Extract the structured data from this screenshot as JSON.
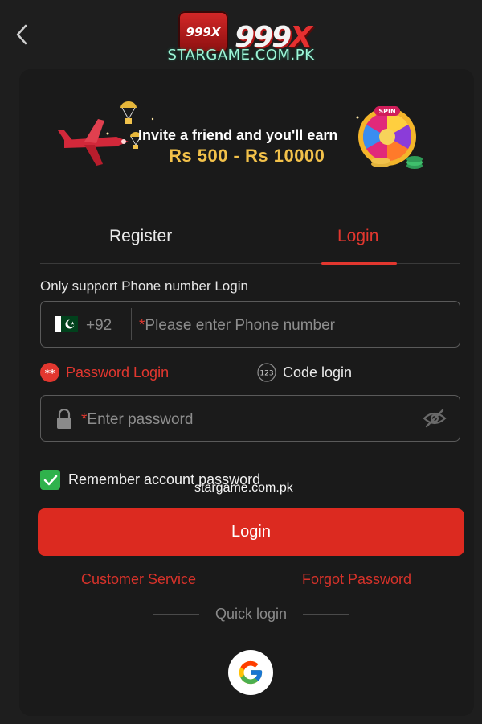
{
  "header": {
    "logo_badge_text": "999X",
    "logo_word_main": "999",
    "logo_word_x": "X",
    "site_caption": "STARGAME.COM.PK"
  },
  "banner": {
    "line1": "Invite a friend and you'll earn",
    "line2": "Rs 500 - Rs 10000",
    "wheel_label": "SPIN"
  },
  "tabs": [
    {
      "label": "Register",
      "active": false
    },
    {
      "label": "Login",
      "active": true
    }
  ],
  "form": {
    "support_text": "Only support Phone number Login",
    "phone": {
      "country_code": "+92",
      "required_mark": "*",
      "placeholder": "Please enter Phone number"
    },
    "modes": {
      "password_badge": "**",
      "password_label": "Password Login",
      "code_badge": "123",
      "code_label": "Code login"
    },
    "password": {
      "required_mark": "*",
      "placeholder": "Enter password"
    },
    "remember": {
      "label": "Remember account password",
      "checked": true
    },
    "watermark": "stargame.com.pk",
    "submit_label": "Login"
  },
  "links": {
    "customer_service": "Customer Service",
    "forgot_password": "Forgot Password"
  },
  "quick_login": {
    "label": "Quick login",
    "providers": [
      "google-icon"
    ]
  },
  "colors": {
    "accent": "#dc2a20",
    "background": "#1e1e1e",
    "card": "#1a1a1a",
    "checkbox": "#2fb24c",
    "caption": "#9ef7d8"
  }
}
